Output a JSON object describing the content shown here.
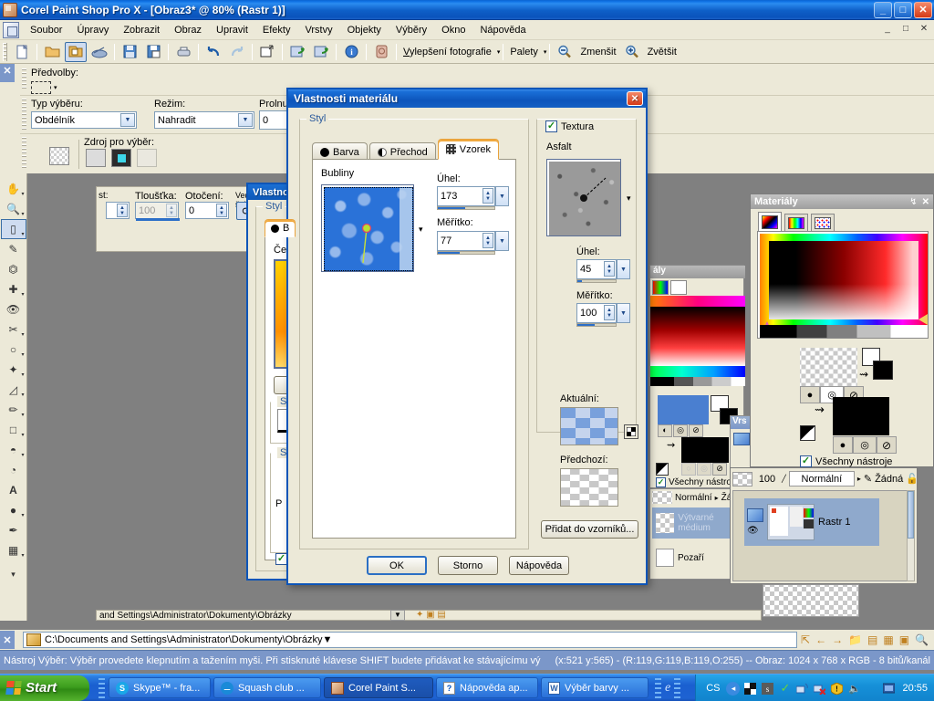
{
  "window": {
    "title": "Corel Paint Shop Pro X - [Obraz3* @  80% (Rastr 1)]",
    "min_label": "_",
    "max_label": "□",
    "close_label": "✕"
  },
  "menu": {
    "items": [
      {
        "label": "Soubor"
      },
      {
        "label": "Úpravy"
      },
      {
        "label": "Zobrazit"
      },
      {
        "label": "Obraz"
      },
      {
        "label": "Upravit"
      },
      {
        "label": "Efekty"
      },
      {
        "label": "Vrstvy"
      },
      {
        "label": "Objekty"
      },
      {
        "label": "Výběry"
      },
      {
        "label": "Okno"
      },
      {
        "label": "Nápověda"
      }
    ],
    "doc_min": "_",
    "doc_max": "□",
    "doc_close": "✕"
  },
  "toolbar": {
    "enhance_photo": "Vylepšení fotografie",
    "palettes": "Palety",
    "zoom_out": "Zmenšit",
    "zoom_in": "Zvětšit",
    "caret": "▾"
  },
  "options_bar": {
    "presets_label": "Předvolby:",
    "selection_type_label": "Typ výběru:",
    "selection_type_value": "Obdélník",
    "mode_label": "Režim:",
    "mode_value": "Nahradit",
    "feather_label": "Prolnutí:",
    "feather_value": "0",
    "source_label": "Zdroj pro výběr:",
    "close": "✕"
  },
  "brush_options_bar": {
    "label_cut": "st:",
    "thickness_label": "Tloušťka:",
    "thickness_value": "100",
    "rotation_label": "Otočení:",
    "rotation_value": "0",
    "tip_label": "Vedení špičk"
  },
  "dialog": {
    "title": "Vlastnosti materiálu",
    "close": "✕",
    "style_group": "Styl",
    "tabs": [
      {
        "label": "Barva",
        "icon": "circle-filled-icon",
        "active": false
      },
      {
        "label": "Přechod",
        "icon": "half-circle-icon",
        "active": false
      },
      {
        "label": "Vzorek",
        "icon": "pattern-grid-icon",
        "active": true
      }
    ],
    "pattern_name": "Bubliny",
    "angle_label": "Úhel:",
    "angle_value": "173",
    "angle_pct": 48,
    "scale_label": "Měřítko:",
    "scale_value": "77",
    "scale_pct": 38,
    "texture": {
      "checkbox_label": "Textura",
      "checked": true,
      "name": "Asfalt",
      "angle_label": "Úhel:",
      "angle_value": "45",
      "angle_pct": 12,
      "scale_label": "Měřítko:",
      "scale_value": "100",
      "scale_pct": 45
    },
    "current_label": "Aktuální:",
    "previous_label": "Předchozí:",
    "add_to_swatches": "Přidat do vzorníků...",
    "ok": "OK",
    "cancel": "Storno",
    "help": "Nápověda"
  },
  "bg_dialog": {
    "title": "Vlastno",
    "style_group": "Styl",
    "tab_label": "B",
    "color_name": "Čer",
    "style_group2": "St",
    "style_group3": "St",
    "p_label": "P"
  },
  "materials_palette": {
    "title": "Materiály",
    "pin": "↯",
    "close": "✕",
    "all_tools_label": "Všechny nástroje",
    "all_tools_checked": true
  },
  "materials_palette_back": {
    "title": "ály",
    "all_tools_label": "Všechny nástroje"
  },
  "layers_palette": {
    "title": "Vrs",
    "opacity": "100",
    "blend_mode": "Normální",
    "mask": "Žádná",
    "layer_name": "Rastr 1",
    "arrow": "▸"
  },
  "layers_palette_back": {
    "opacity": "",
    "blend_mode": "Normální",
    "mask": "Žádn",
    "row1": "Výtvarné médium",
    "row2": "Pozaří"
  },
  "path_bar": {
    "close": "✕",
    "path": "C:\\Documents and Settings\\Administrator\\Dokumenty\\Obrázky"
  },
  "status_bar": {
    "hint": "Nástroj Výběr: Výběr provedete klepnutím a tažením myši. Při stisknuté klávese SHIFT budete přidávat ke stávajícímu výb",
    "coords": "(x:521 y:565) - (R:119,G:119,B:119,O:255) -- Obraz:  1024 x 768 x RGB - 8 bitů/kanál"
  },
  "taskbar": {
    "start": "Start",
    "items": [
      {
        "label": "Skype™ - fra...",
        "icon": "skype-icon",
        "active": false
      },
      {
        "label": "Squash club ...",
        "icon": "chat-icon",
        "active": false
      },
      {
        "label": "Corel Paint S...",
        "icon": "psp-icon",
        "active": true
      },
      {
        "label": "Nápověda ap...",
        "icon": "help-icon",
        "active": false
      },
      {
        "label": "Výběr barvy ...",
        "icon": "word-icon",
        "active": false
      }
    ],
    "quicklaunch_icon": "ie-icon",
    "language": "CS",
    "time": "20:55"
  },
  "colors": {
    "accent_blue": "#0d55b8",
    "dialog_face": "#ece9d8",
    "title_blue": "#1a6fd4",
    "status_blue": "#7b97c9",
    "tab_orange": "#e8a23c",
    "start_green": "#3d9e1e"
  }
}
